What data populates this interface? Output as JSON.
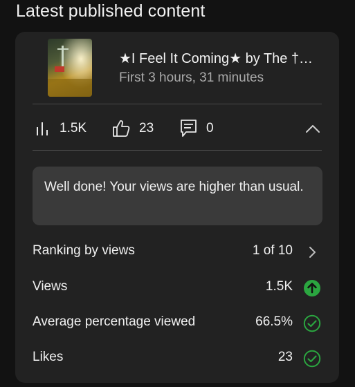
{
  "section_title": "Latest published content",
  "video": {
    "title": "★I Feel It Coming★ by The †…",
    "subtitle": "First 3 hours, 31 minutes"
  },
  "stats": {
    "views": "1.5K",
    "likes": "23",
    "comments": "0"
  },
  "message": "Well done! Your views are higher than usual.",
  "metrics": [
    {
      "label": "Ranking by views",
      "value": "1 of 10",
      "icon": "chevron-right-icon"
    },
    {
      "label": "Views",
      "value": "1.5K",
      "icon": "arrow-up-circle-icon"
    },
    {
      "label": "Average percentage viewed",
      "value": "66.5%",
      "icon": "check-circle-icon"
    },
    {
      "label": "Likes",
      "value": "23",
      "icon": "check-circle-icon"
    }
  ],
  "colors": {
    "background": "#121212",
    "card": "#222222",
    "message_box": "#3a3a3a",
    "accent_green": "#2ba640",
    "secondary_text": "#aaaaaa"
  }
}
